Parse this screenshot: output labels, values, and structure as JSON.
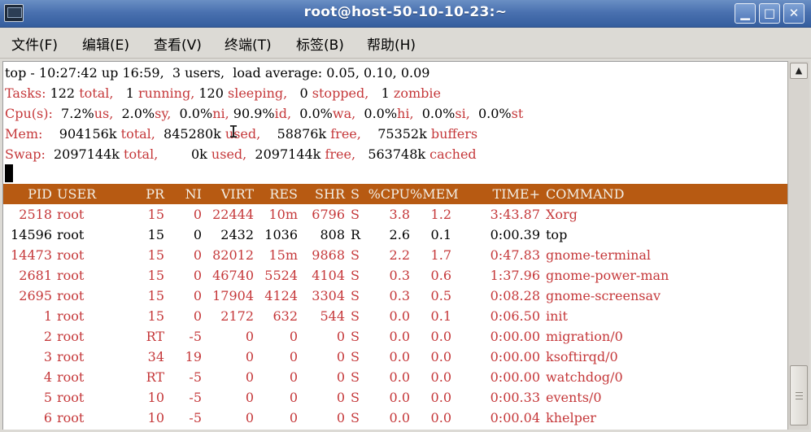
{
  "window": {
    "title": "root@host-50-10-10-23:~",
    "buttons": {
      "minimize": "▁",
      "maximize": "□",
      "close": "✕"
    }
  },
  "menu": [
    "文件(F)",
    "编辑(E)",
    "查看(V)",
    "终端(T)",
    "标签(B)",
    "帮助(H)"
  ],
  "summary": {
    "top": "top - 10:27:42 up 16:59,  3 users,  load average: 0.05, 0.10, 0.09",
    "tasks": {
      "label": "Tasks: ",
      "total": "122",
      "total_l": " total,   ",
      "running": "1",
      "running_l": " running, ",
      "sleeping": "120",
      "sleeping_l": " sleeping,   ",
      "stopped": "0",
      "stopped_l": " stopped,   ",
      "zombie": "1",
      "zombie_l": " zombie"
    },
    "cpu": {
      "label": "Cpu(s):  ",
      "us": "7.2%",
      "us_l": "us,  ",
      "sy": "2.0%",
      "sy_l": "sy,  ",
      "ni": "0.0%",
      "ni_l": "ni, ",
      "id": "90.9%",
      "id_l": "id,  ",
      "wa": "0.0%",
      "wa_l": "wa,  ",
      "hi": "0.0%",
      "hi_l": "hi,  ",
      "si": "0.0%",
      "si_l": "si,  ",
      "st": "0.0%",
      "st_l": "st"
    },
    "mem": {
      "label": "Mem:    ",
      "total": "904156k",
      "total_l": " total,  ",
      "used": "845280k",
      "used_l": " used,    ",
      "free": "58876k",
      "free_l": " free,    ",
      "buffers": "75352k",
      "buffers_l": " buffers"
    },
    "swap": {
      "label": "Swap:  ",
      "total": "2097144k",
      "total_l": " total,        ",
      "used": "0k",
      "used_l": " used,  ",
      "free": "2097144k",
      "free_l": " free,   ",
      "cached": "563748k",
      "cached_l": " cached"
    }
  },
  "columns": [
    "PID",
    "USER",
    "PR",
    "NI",
    "VIRT",
    "RES",
    "SHR",
    "S",
    "%CPU",
    "%MEM",
    "TIME+",
    "COMMAND"
  ],
  "processes": [
    [
      "2518",
      "root",
      "15",
      "0",
      "22444",
      "10m",
      "6796",
      "S",
      "3.8",
      "1.2",
      "3:43.87",
      "Xorg"
    ],
    [
      "14596",
      "root",
      "15",
      "0",
      "2432",
      "1036",
      "808",
      "R",
      "2.6",
      "0.1",
      "0:00.39",
      "top"
    ],
    [
      "14473",
      "root",
      "15",
      "0",
      "82012",
      "15m",
      "9868",
      "S",
      "2.2",
      "1.7",
      "0:47.83",
      "gnome-terminal"
    ],
    [
      "2681",
      "root",
      "15",
      "0",
      "46740",
      "5524",
      "4104",
      "S",
      "0.3",
      "0.6",
      "1:37.96",
      "gnome-power-man"
    ],
    [
      "2695",
      "root",
      "15",
      "0",
      "17904",
      "4124",
      "3304",
      "S",
      "0.3",
      "0.5",
      "0:08.28",
      "gnome-screensav"
    ],
    [
      "1",
      "root",
      "15",
      "0",
      "2172",
      "632",
      "544",
      "S",
      "0.0",
      "0.1",
      "0:06.50",
      "init"
    ],
    [
      "2",
      "root",
      "RT",
      "-5",
      "0",
      "0",
      "0",
      "S",
      "0.0",
      "0.0",
      "0:00.00",
      "migration/0"
    ],
    [
      "3",
      "root",
      "34",
      "19",
      "0",
      "0",
      "0",
      "S",
      "0.0",
      "0.0",
      "0:00.00",
      "ksoftirqd/0"
    ],
    [
      "4",
      "root",
      "RT",
      "-5",
      "0",
      "0",
      "0",
      "S",
      "0.0",
      "0.0",
      "0:00.00",
      "watchdog/0"
    ],
    [
      "5",
      "root",
      "10",
      "-5",
      "0",
      "0",
      "0",
      "S",
      "0.0",
      "0.0",
      "0:00.33",
      "events/0"
    ],
    [
      "6",
      "root",
      "10",
      "-5",
      "0",
      "0",
      "0",
      "S",
      "0.0",
      "0.0",
      "0:00.04",
      "khelper"
    ]
  ],
  "colors": {
    "header_bg": "#b75a12",
    "highlight_text": "#c5383a",
    "normal_text": "#000000",
    "current_process_row_color": "#000000"
  },
  "icons": {
    "app": "terminal-icon",
    "scroll_up": "▲"
  }
}
